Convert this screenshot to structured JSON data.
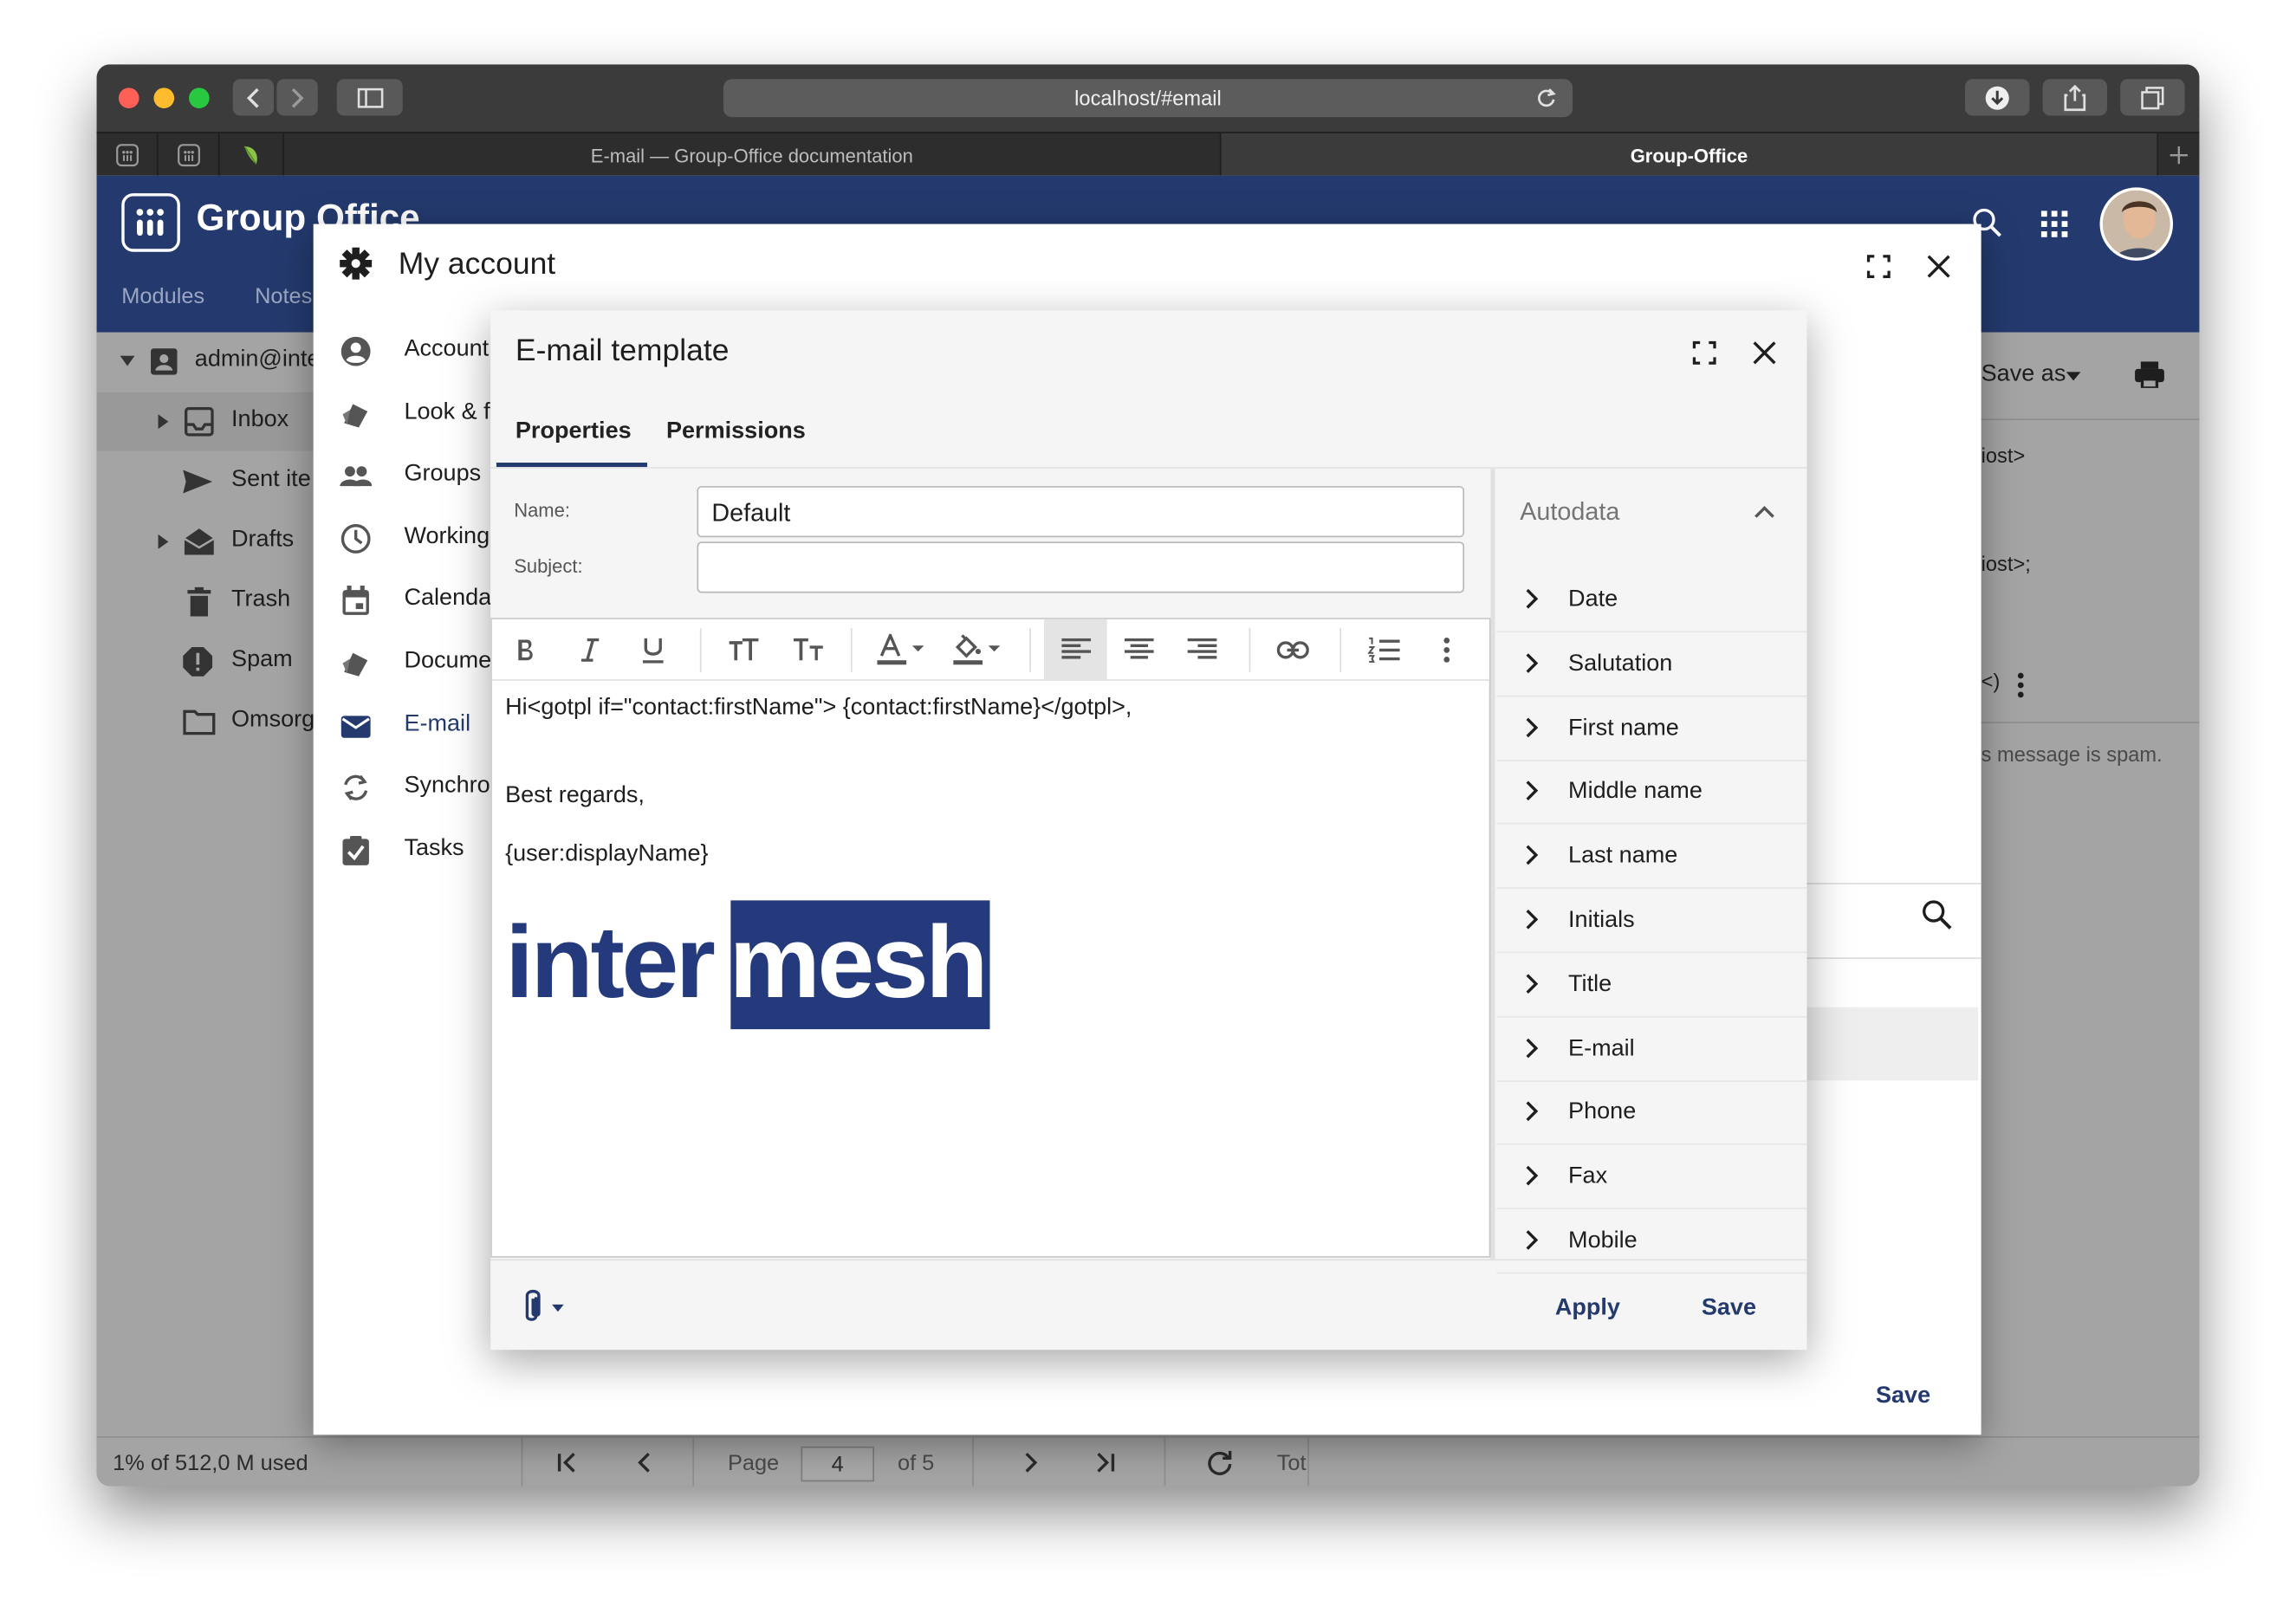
{
  "browser": {
    "url": "localhost/#email",
    "tabs": [
      "E-mail — Group-Office documentation",
      "Group-Office"
    ]
  },
  "app": {
    "title": "Group Office",
    "nav": [
      "Modules",
      "Notes"
    ],
    "account": "admin@inte",
    "folders": [
      "Inbox",
      "Sent ite",
      "Drafts",
      "Trash",
      "Spam",
      "Omsorg"
    ],
    "right_toolbar": {
      "save_as": "Save as"
    },
    "bg_text": [
      "iost>",
      "iost>;",
      "s message is spam.",
      "<)"
    ],
    "status": {
      "quota": "1% of 512,0 M used",
      "page_label": "Page",
      "page_value": "4",
      "of_label": "of 5",
      "total_label": "Tot"
    }
  },
  "my_account": {
    "title": "My account",
    "menu": [
      "Account",
      "Look & f",
      "Groups",
      "Working",
      "Calenda",
      "Docume",
      "E-mail",
      "Synchro",
      "Tasks"
    ],
    "save_label": "Save"
  },
  "template": {
    "title": "E-mail template",
    "tabs": [
      "Properties",
      "Permissions"
    ],
    "name_label": "Name:",
    "name_value": "Default",
    "subject_label": "Subject:",
    "subject_value": "",
    "body": [
      "Hi<gotpl if=\"contact:firstName\"> {contact:firstName}</gotpl>,",
      "Best regards,",
      "{user:displayName}"
    ],
    "logo": {
      "part1": "inter",
      "part2": "mesh"
    },
    "autodata_title": "Autodata",
    "autodata_items": [
      "Date",
      "Salutation",
      "First name",
      "Middle name",
      "Last name",
      "Initials",
      "Title",
      "E-mail",
      "Phone",
      "Fax",
      "Mobile"
    ],
    "apply_label": "Apply",
    "save_label": "Save"
  },
  "colors": {
    "brand": "#243a6e",
    "logo_blue": "#2b3a8a",
    "traffic": [
      "#fe5f57",
      "#febc2e",
      "#28c840"
    ]
  }
}
